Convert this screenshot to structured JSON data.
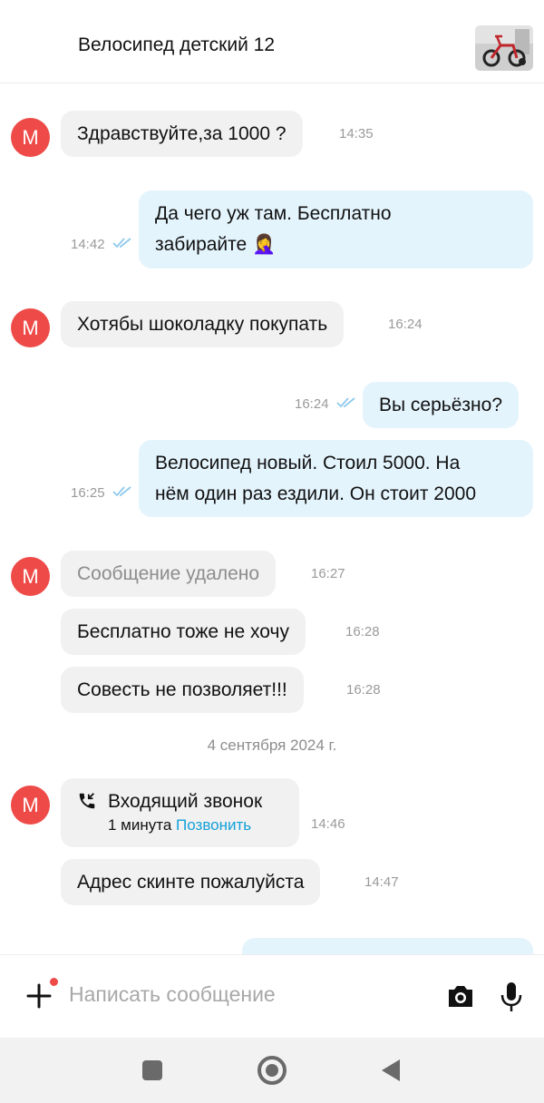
{
  "header": {
    "title": "Велосипед детский 12",
    "thumbnail_icon": "bicycle-thumbnail"
  },
  "avatar_letter": "М",
  "messages": [
    {
      "direction": "in",
      "text": "Здравствуйте,за 1000 ?",
      "time": "14:35"
    },
    {
      "direction": "out",
      "lines": [
        "Да чего уж там. Бесплатно",
        "забирайте 🤦‍♀️"
      ],
      "time": "14:42",
      "read": true
    },
    {
      "direction": "in",
      "text": "Хотябы шоколадку покупать",
      "time": "16:24"
    },
    {
      "direction": "out",
      "text": "Вы серьёзно?",
      "time": "16:24",
      "read": true
    },
    {
      "direction": "out",
      "lines": [
        "Велосипед новый. Стоил 5000. На",
        "нём один раз ездили. Он стоит 2000"
      ],
      "time": "16:25",
      "read": true
    },
    {
      "direction": "in",
      "text": "Сообщение удалено",
      "time": "16:27",
      "deleted": true
    },
    {
      "direction": "in",
      "text": "Бесплатно тоже не хочу",
      "time": "16:28"
    },
    {
      "direction": "in",
      "text": "Совесть не позволяет!!!",
      "time": "16:28"
    }
  ],
  "date_separator": "4 сентября 2024 г.",
  "call": {
    "title": "Входящий звонок",
    "duration": "1 минута",
    "action": "Позвонить",
    "time": "14:46",
    "icon": "phone-incoming-icon"
  },
  "last_incoming": {
    "text": "Адрес скинте пожалуйста",
    "time": "14:47"
  },
  "composer": {
    "placeholder": "Написать сообщение",
    "attach_icon": "plus-icon",
    "camera_icon": "camera-icon",
    "mic_icon": "microphone-icon"
  },
  "colors": {
    "accent_red": "#ee4b48",
    "incoming_bubble": "#f1f1f1",
    "outgoing_bubble": "#e4f4fd",
    "link_blue": "#13a0d8",
    "read_ticks": "#8fc9ec"
  }
}
